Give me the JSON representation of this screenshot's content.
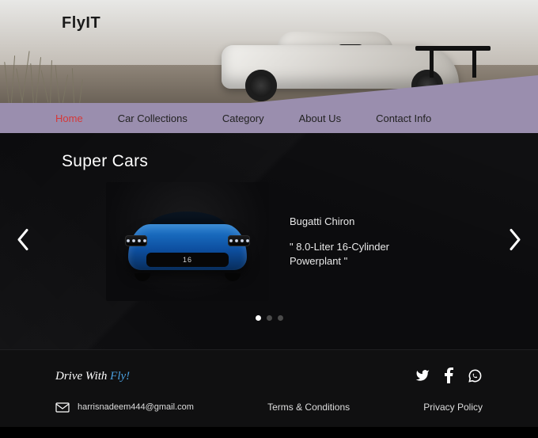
{
  "brand": "FlyIT",
  "nav": {
    "items": [
      {
        "label": "Home",
        "active": true
      },
      {
        "label": "Car Collections",
        "active": false
      },
      {
        "label": "Category",
        "active": false
      },
      {
        "label": "About Us",
        "active": false
      },
      {
        "label": "Contact Info",
        "active": false
      }
    ]
  },
  "main": {
    "section_title": "Super Cars",
    "car": {
      "name": "Bugatti Chiron",
      "spec": "\" 8.0-Liter 16-Cylinder Powerplant \"",
      "badge": "16"
    },
    "carousel": {
      "count": 3,
      "active_index": 0
    }
  },
  "footer": {
    "slogan_prefix": "Drive With ",
    "slogan_accent": "Fly!",
    "email": "harrisnadeem444@gmail.com",
    "links": {
      "terms": "Terms & Conditions",
      "privacy": "Privacy Policy"
    },
    "socials": [
      "twitter",
      "facebook",
      "whatsapp"
    ]
  },
  "colors": {
    "nav_bg": "#9a8eae",
    "accent": "#d63838",
    "link_blue": "#4aa0e0"
  }
}
